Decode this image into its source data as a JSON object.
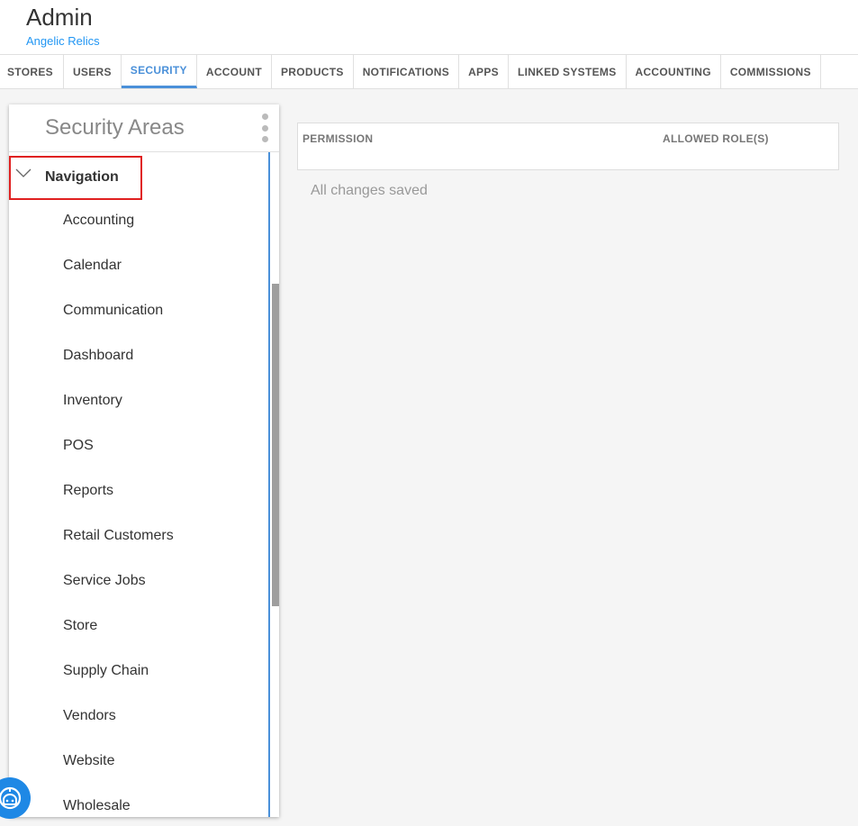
{
  "header": {
    "title": "Admin",
    "subtitle": "Angelic Relics"
  },
  "tabs": [
    {
      "label": "STORES",
      "active": false
    },
    {
      "label": "USERS",
      "active": false
    },
    {
      "label": "SECURITY",
      "active": true
    },
    {
      "label": "ACCOUNT",
      "active": false
    },
    {
      "label": "PRODUCTS",
      "active": false
    },
    {
      "label": "NOTIFICATIONS",
      "active": false
    },
    {
      "label": "APPS",
      "active": false
    },
    {
      "label": "LINKED SYSTEMS",
      "active": false
    },
    {
      "label": "ACCOUNTING",
      "active": false
    },
    {
      "label": "COMMISSIONS",
      "active": false
    }
  ],
  "security_panel": {
    "title": "Security Areas",
    "menu_icon": "kebab-vertical-icon",
    "group": {
      "label": "Navigation",
      "icon": "chevron-down-icon",
      "expanded": true,
      "items": [
        "Accounting",
        "Calendar",
        "Communication",
        "Dashboard",
        "Inventory",
        "POS",
        "Reports",
        "Retail Customers",
        "Service Jobs",
        "Store",
        "Supply Chain",
        "Vendors",
        "Website",
        "Wholesale"
      ]
    }
  },
  "permissions_grid": {
    "columns": [
      "PERMISSION",
      "ALLOWED ROLE(S)"
    ]
  },
  "status": "All changes saved",
  "help_button_icon": "help-bot-icon",
  "colors": {
    "accent": "#4a90d9",
    "subtitle": "#2196f3",
    "highlight_border": "#e02020",
    "help_button": "#1e88e5"
  }
}
